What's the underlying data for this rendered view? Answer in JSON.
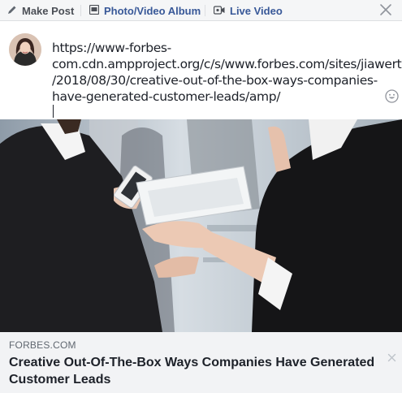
{
  "tabs": [
    {
      "label": "Make Post",
      "icon": "pencil-icon"
    },
    {
      "label": "Photo/Video Album",
      "icon": "photo-album-icon"
    },
    {
      "label": "Live Video",
      "icon": "video-camera-icon"
    }
  ],
  "composer": {
    "text_lines": [
      "https://www-forbes-",
      "com.cdn.ampproject.org/c/s/www.forbes.com/sites/jiawertz",
      "/2018/08/30/creative-out-of-the-box-ways-companies-",
      "have-generated-customer-leads/amp/"
    ]
  },
  "preview": {
    "domain": "FORBES.COM",
    "headline": "Creative Out-Of-The-Box Ways Companies Have Generated Customer Leads"
  },
  "colors": {
    "link_blue": "#385898",
    "tab_bg": "#f5f6f7",
    "meta_bg": "#f2f3f5",
    "text": "#1d2129"
  }
}
